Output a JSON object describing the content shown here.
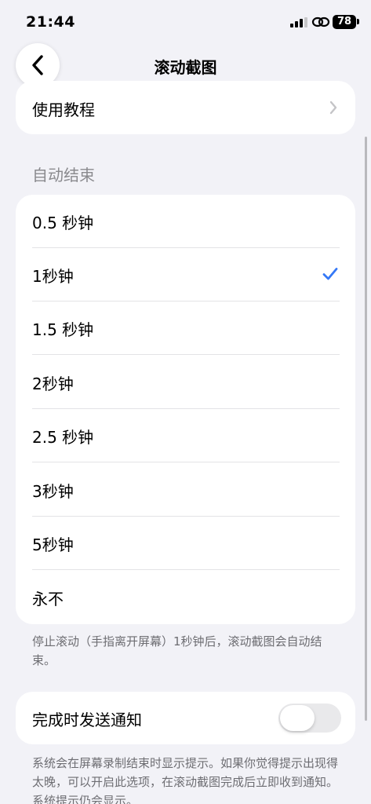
{
  "status_bar": {
    "time": "21:44",
    "battery": "78",
    "icons": [
      "signal-icon",
      "link-icon",
      "battery-icon"
    ]
  },
  "nav": {
    "title": "滚动截图",
    "back_icon": "chevron-left-icon"
  },
  "tutorial": {
    "label": "使用教程",
    "icon": "chevron-right-icon"
  },
  "auto_end": {
    "header": "自动结束",
    "options": [
      {
        "label": "0.5 秒钟",
        "selected": false
      },
      {
        "label": "1秒钟",
        "selected": true
      },
      {
        "label": "1.5 秒钟",
        "selected": false
      },
      {
        "label": "2秒钟",
        "selected": false
      },
      {
        "label": "2.5 秒钟",
        "selected": false
      },
      {
        "label": "3秒钟",
        "selected": false
      },
      {
        "label": "5秒钟",
        "selected": false
      },
      {
        "label": "永不",
        "selected": false
      }
    ],
    "footnote": "停止滚动（手指离开屏幕）1秒钟后，滚动截图会自动结束。"
  },
  "notify": {
    "label": "完成时发送通知",
    "enabled": false,
    "footnote": "系统会在屏幕录制结束时显示提示。如果你觉得提示出现得太晚，可以开启此选项，在滚动截图完成后立即收到通知。系统提示仍会显示。"
  },
  "colors": {
    "accent": "#3478f6",
    "background": "#f2f2f7",
    "card": "#ffffff",
    "secondary_text": "#8a8a8e"
  }
}
